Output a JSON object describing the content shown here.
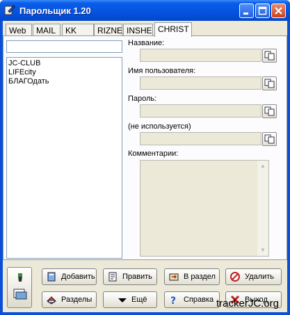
{
  "window": {
    "title": "Парольщик 1.20"
  },
  "tabs": [
    "Web",
    "MAIL",
    "KK",
    "RIZNE",
    "INSHE",
    "CHRIST"
  ],
  "active_tab": "CHRIST",
  "search": {
    "value": ""
  },
  "list": [
    "JC-CLUB",
    "LIFEcity",
    "БЛАГОдать"
  ],
  "fields": {
    "name_label": "Название:",
    "user_label": "Имя пользователя:",
    "password_label": "Пароль:",
    "unused_label": "(не используется)",
    "comments_label": "Комментарии:"
  },
  "buttons": {
    "add": "Добавить",
    "edit": "Править",
    "to_section": "В раздел",
    "delete": "Удалить",
    "sections": "Разделы",
    "more": "Ещё",
    "help": "Справка",
    "exit": "Выход"
  },
  "watermark": "trackerJC.org"
}
